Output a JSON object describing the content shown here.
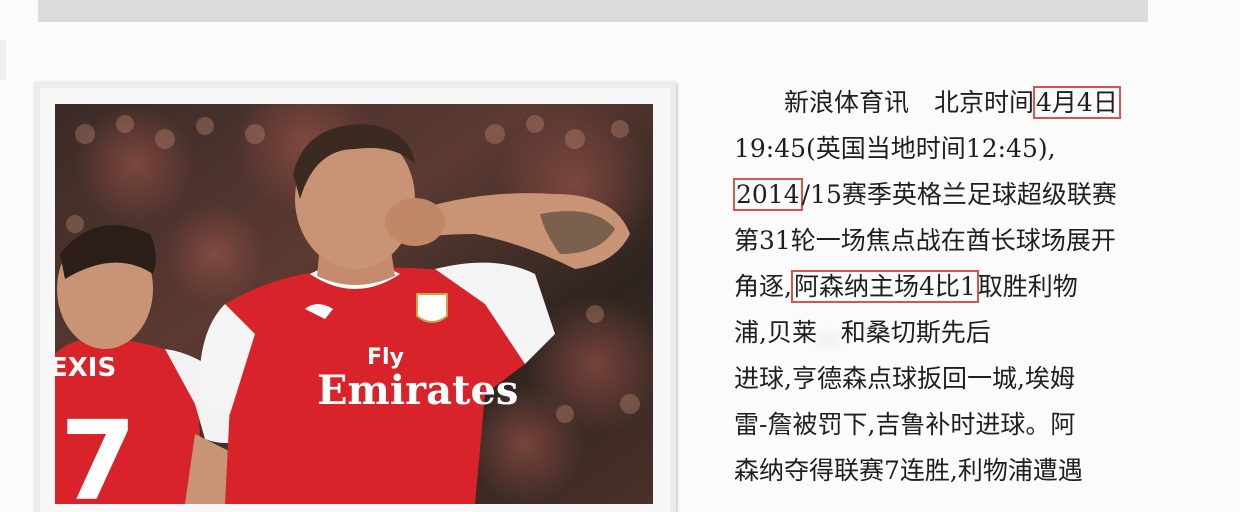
{
  "article": {
    "lines": [
      {
        "pre": "　　新浪体育讯　北京时间",
        "hl": "4月4日",
        "post": ""
      },
      {
        "pre": "19:45(英国当地时间12:45),",
        "hl": "",
        "post": ""
      },
      {
        "pre": "",
        "hl": "2014",
        "post": "/15赛季英格兰足球超级联赛"
      },
      {
        "pre": "第31轮一场焦点战在酋长球场展开",
        "hl": "",
        "post": ""
      },
      {
        "pre": "角逐,",
        "hl": "阿森纳主场4比1",
        "post": "取胜利物"
      },
      {
        "pre": "浦,贝莱",
        "blur": "...",
        "post": "和桑切斯先后"
      },
      {
        "pre": "进球,亨德森点球扳回一城,埃姆",
        "hl": "",
        "post": ""
      },
      {
        "pre": "雷-詹被罚下,吉鲁补时进球。阿",
        "hl": "",
        "post": ""
      },
      {
        "pre": "森纳夺得联赛7连胜,利物浦遭遇",
        "hl": "",
        "post": ""
      }
    ]
  },
  "photo": {
    "sponsor_line1": "Fly",
    "sponsor_line2": "Emirates",
    "jersey_name": "EXIS",
    "jersey_number": "7"
  },
  "colors": {
    "highlight_box": "#d9544f",
    "shirt_red": "#d8232a"
  }
}
